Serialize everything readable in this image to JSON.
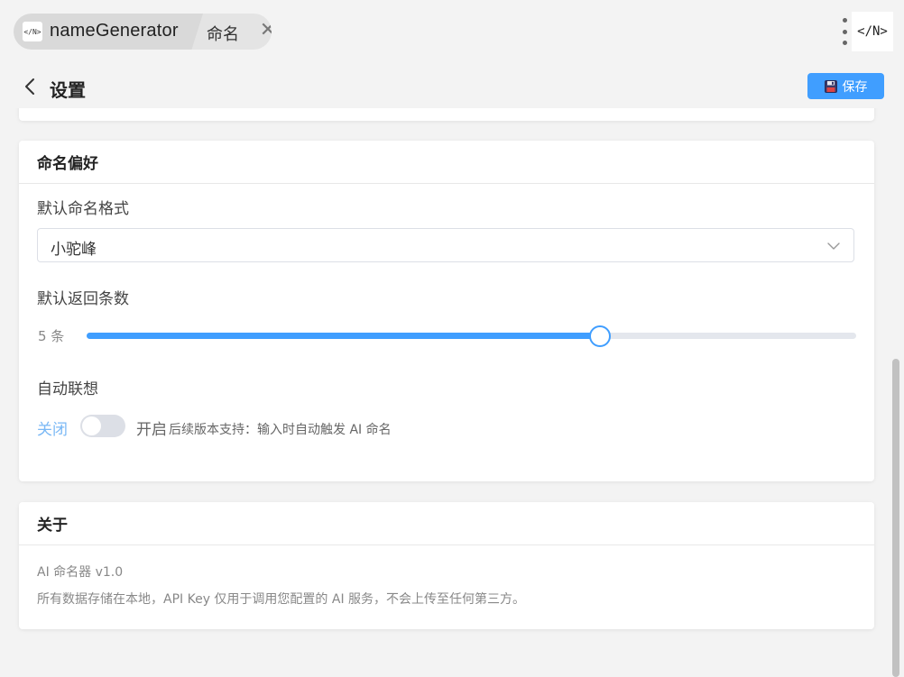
{
  "tabs": {
    "app_icon": "</N>",
    "app_label": "nameGenerator",
    "sub_label": "命名",
    "close_glyph": "✕"
  },
  "logo_text": "</N>",
  "header": {
    "title": "设置",
    "save_label": "保存"
  },
  "preferences": {
    "title": "命名偏好",
    "format_label": "默认命名格式",
    "format_value": "小驼峰",
    "count_label": "默认返回条数",
    "count_value": "5 条",
    "count_slider_fraction": 0.667,
    "autosuggest_label": "自动联想",
    "switch_off_label": "关闭",
    "switch_on_label": "开启",
    "switch_hint": "后续版本支持：输入时自动触发 AI 命名",
    "switch_state": false
  },
  "about": {
    "title": "关于",
    "version": "AI 命名器 v1.0",
    "description": "所有数据存储在本地，API Key 仅用于调用您配置的 AI 服务，不会上传至任何第三方。"
  },
  "colors": {
    "accent": "#409eff",
    "background": "#f3f3f3"
  }
}
